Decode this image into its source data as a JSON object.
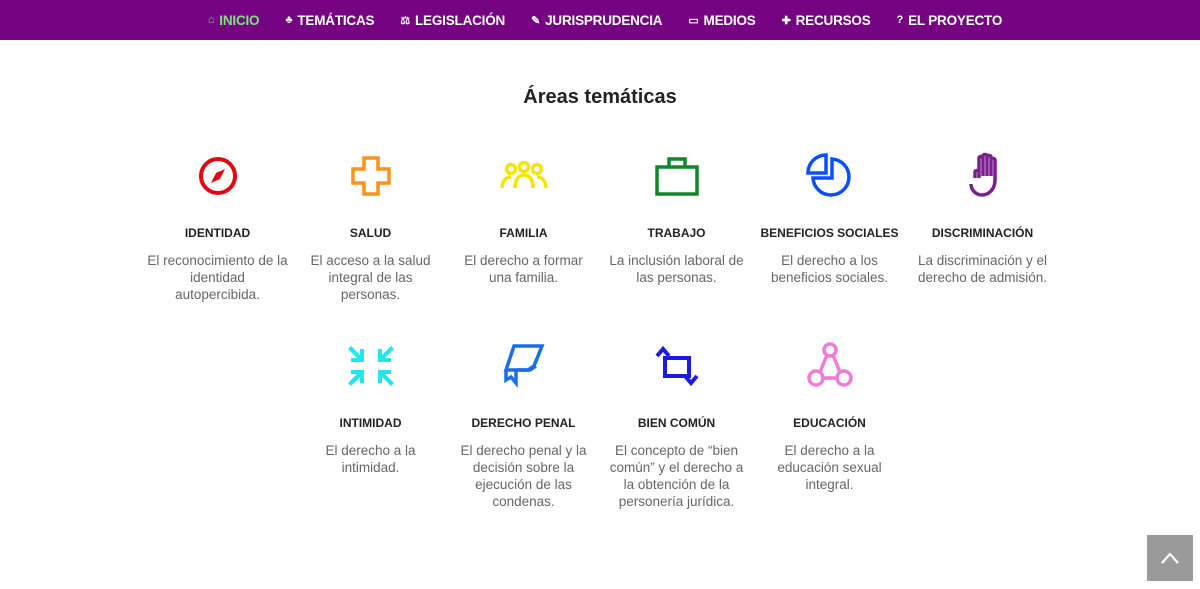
{
  "nav": {
    "items": [
      {
        "label": "INICIO",
        "icon": "home-icon",
        "glyph": "⌂",
        "active": true
      },
      {
        "label": "TEMÁTICAS",
        "icon": "sitemap-icon",
        "glyph": "♣"
      },
      {
        "label": "LEGISLACIÓN",
        "icon": "scale-icon",
        "glyph": "⚖"
      },
      {
        "label": "JURISPRUDENCIA",
        "icon": "gavel-icon",
        "glyph": "✎"
      },
      {
        "label": "MEDIOS",
        "icon": "media-icon",
        "glyph": "▭"
      },
      {
        "label": "RECURSOS",
        "icon": "resources-icon",
        "glyph": "✚"
      },
      {
        "label": "EL PROYECTO",
        "icon": "question-icon",
        "glyph": "?"
      }
    ]
  },
  "heading": "Áreas temáticas",
  "areas": [
    {
      "title": "IDENTIDAD",
      "desc": "El reconocimiento de la identidad autopercibida.",
      "icon": "compass-icon",
      "color": "#e30613"
    },
    {
      "title": "SALUD",
      "desc": "El acceso a la salud integral de las personas.",
      "icon": "health-cross-icon",
      "color": "#f7931e"
    },
    {
      "title": "FAMILIA",
      "desc": "El derecho a formar una familia.",
      "icon": "family-icon",
      "color": "#f5e400"
    },
    {
      "title": "TRABAJO",
      "desc": "La inclusión laboral de las personas.",
      "icon": "briefcase-icon",
      "color": "#12862a"
    },
    {
      "title": "BENEFICIOS SOCIALES",
      "desc": "El derecho a los beneficios sociales.",
      "icon": "pie-chart-icon",
      "color": "#0a4fff"
    },
    {
      "title": "DISCRIMINACIÓN",
      "desc": "La discriminación y el derecho de admisión.",
      "icon": "hand-icon",
      "color": "#7b1f8e"
    },
    {
      "title": "INTIMIDAD",
      "desc": "El derecho a la intimidad.",
      "icon": "compress-arrows-icon",
      "color": "#22e6ef"
    },
    {
      "title": "DERECHO PENAL",
      "desc": "El derecho penal y la decisión sobre la ejecución de las condenas.",
      "icon": "certificate-icon",
      "color": "#1a6fe8"
    },
    {
      "title": "BIEN COMÚN",
      "desc": "El concepto de “bien común” y el derecho a la obtención de la personería jurídica.",
      "icon": "retweet-icon",
      "color": "#1a1ae0"
    },
    {
      "title": "EDUCACIÓN",
      "desc": "El derecho a la educación sexual integral.",
      "icon": "nodes-icon",
      "color": "#f27ad8"
    }
  ],
  "scroll_top": {
    "icon": "chevron-up-icon"
  }
}
